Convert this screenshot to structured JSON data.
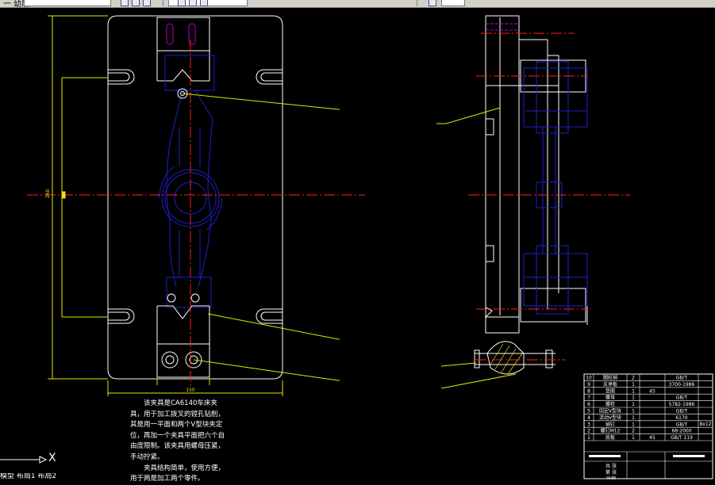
{
  "toolbar": {
    "layer_field": "",
    "layer_text": "一 幼层"
  },
  "notes": {
    "para1": "该夹具是CA6140车床夹具，用于加工拨叉的镗孔钻削，其是用一平面和两个V型块夹定位，再加一个夹具平面把六个自由度限制。该夹具用螺母压紧，手动拧紧。",
    "para2": "夹具结构简单，使用方便，用于两是加工两个零件。"
  },
  "ucs": {
    "x_label": "X"
  },
  "command_line": "模型  布局1  布局2",
  "dimensions": {
    "plate_width": "150",
    "plate_height": "260"
  },
  "title_block": {
    "parts": [
      {
        "no": "10",
        "name": "圆柱销",
        "qty": "2",
        "material": "",
        "standard": "GB/T"
      },
      {
        "no": "9",
        "name": "支承板",
        "qty": "1",
        "material": "",
        "standard": "3700-1986"
      },
      {
        "no": "8",
        "name": "垫圈",
        "qty": "1",
        "material": "45",
        "standard": ""
      },
      {
        "no": "7",
        "name": "螺母",
        "qty": "1",
        "material": "",
        "standard": "GB/T"
      },
      {
        "no": "6",
        "name": "螺栓",
        "qty": "1",
        "material": "",
        "standard": "5782-1986"
      },
      {
        "no": "5",
        "name": "固定V型块",
        "qty": "1",
        "material": "",
        "standard": "GB/T"
      },
      {
        "no": "4",
        "name": "活动V型块",
        "qty": "1",
        "material": "",
        "standard": "6170"
      },
      {
        "no": "3",
        "name": "销钉",
        "qty": "1",
        "material": "",
        "standard": "GB/T"
      },
      {
        "no": "2",
        "name": "螺钉M12",
        "qty": "2",
        "material": "",
        "standard": "68-2000"
      },
      {
        "no": "1",
        "name": "底板",
        "qty": "1",
        "material": "45",
        "standard": "GB/T 119"
      }
    ],
    "side_note": "8x12",
    "footer": [
      "共  张",
      "第  张",
      "比例"
    ]
  },
  "colors": {
    "background": "#000000",
    "outline": "#ffffff",
    "part": "#2020c8",
    "centerline": "#ff2020",
    "dimension": "#e6e600",
    "leader": "#e6e600",
    "hidden": "#c000c0"
  }
}
